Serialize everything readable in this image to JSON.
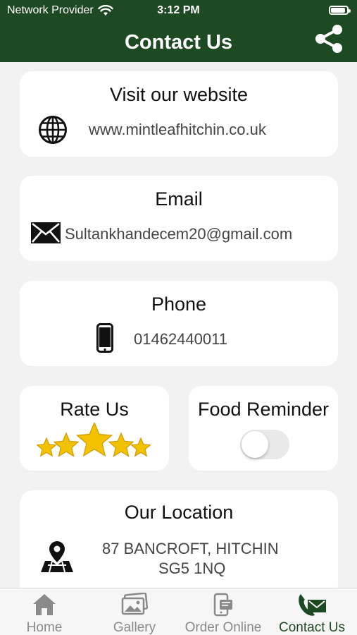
{
  "status_bar": {
    "carrier": "Network Provider",
    "time": "3:12 PM",
    "battery_level": 0.9
  },
  "header": {
    "title": "Contact Us"
  },
  "website": {
    "title": "Visit our website",
    "url": "www.mintleafhitchin.co.uk"
  },
  "email": {
    "title": "Email",
    "address": "Sultankhandecem20@gmail.com"
  },
  "phone": {
    "title": "Phone",
    "number": "01462440011"
  },
  "rate": {
    "title": "Rate Us",
    "stars": 5
  },
  "reminder": {
    "title": "Food Reminder",
    "enabled": false
  },
  "location": {
    "title": "Our Location",
    "line1": "87 BANCROFT, HITCHIN",
    "line2": "SG5 1NQ"
  },
  "tabs": [
    {
      "label": "Home",
      "icon": "home-icon"
    },
    {
      "label": "Gallery",
      "icon": "gallery-icon"
    },
    {
      "label": "Order Online",
      "icon": "order-online-icon"
    },
    {
      "label": "Contact Us",
      "icon": "contact-icon",
      "active": true
    }
  ],
  "colors": {
    "primary": "#1d4a22",
    "star": "#f2c200",
    "background": "#f2f2f2"
  }
}
